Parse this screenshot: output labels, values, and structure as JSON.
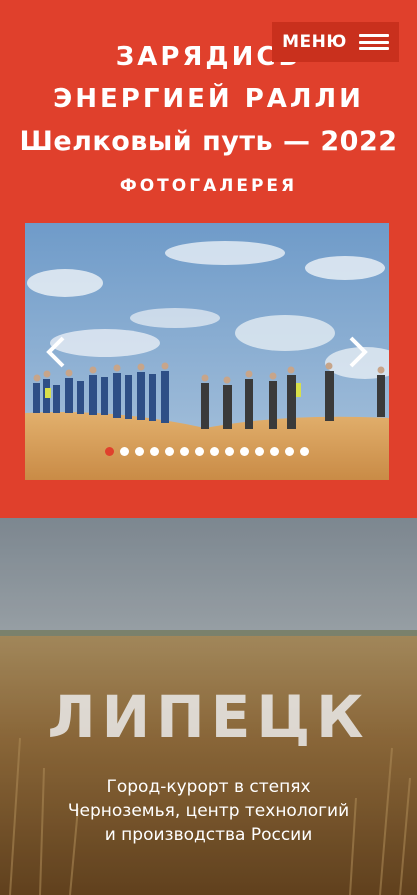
{
  "header": {
    "title_line1": "ЗАРЯДИСЬ",
    "title_line2": "ЭНЕРГИЕЙ РАЛЛИ",
    "title_line3": "Шелковый путь — 2022",
    "section_label": "ФОТОГАЛЕРЕЯ"
  },
  "menu": {
    "label": "МЕНЮ",
    "icon": "hamburger-icon"
  },
  "gallery": {
    "prev_icon": "chevron-left-icon",
    "next_icon": "chevron-right-icon",
    "slide_count": 14,
    "active_index": 0,
    "image": "group of people standing on a sand dune under blue sky"
  },
  "city": {
    "name": "ЛИПЕЦК",
    "description": "Город-курорт в степях Черноземья, центр технологий и производства России",
    "background": "wheat field under cloudy sky"
  },
  "colors": {
    "accent": "#e0402c",
    "menu_bg": "#c9301d",
    "text": "#ffffff"
  }
}
